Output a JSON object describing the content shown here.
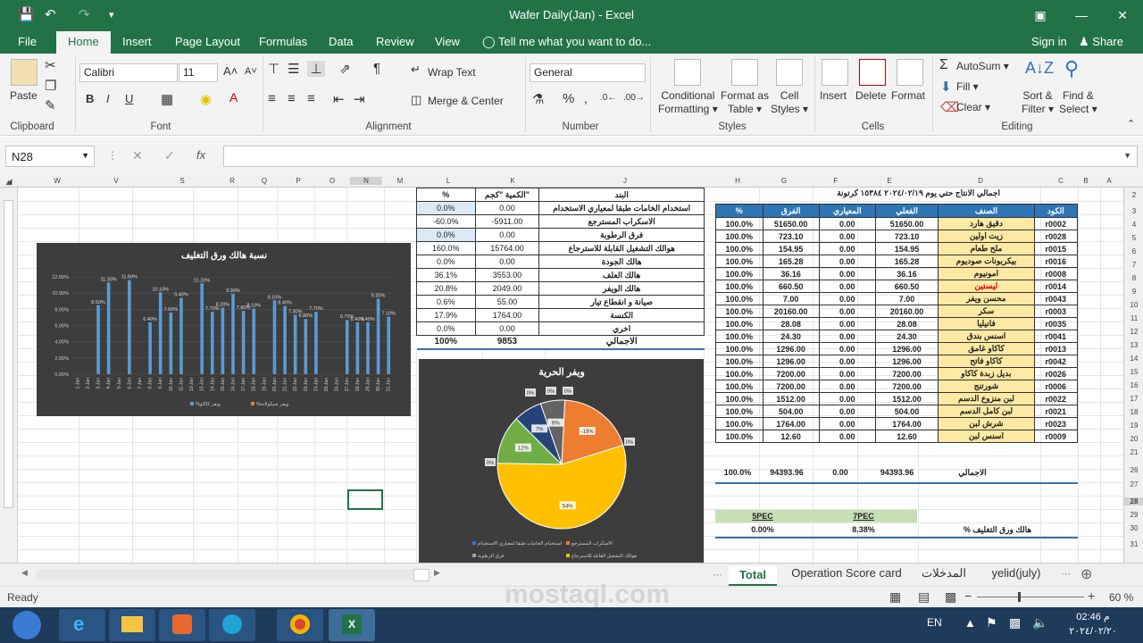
{
  "window": {
    "title": "Wafer Daily(Jan)  -  Excel",
    "sign_in": "Sign in",
    "share": "Share"
  },
  "tabs": [
    "File",
    "Home",
    "Insert",
    "Page Layout",
    "Formulas",
    "Data",
    "Review",
    "View"
  ],
  "tell_me": "Tell me what you want to do...",
  "ribbon": {
    "paste": "Paste",
    "clipboard": "Clipboard",
    "font_name": "Calibri",
    "font_size": "11",
    "font": "Font",
    "wrap_text": "Wrap Text",
    "merge_center": "Merge & Center",
    "alignment": "Alignment",
    "number_format": "General",
    "number": "Number",
    "conditional": "Conditional",
    "formatting": "Formatting",
    "format_as": "Format as",
    "table": "Table",
    "cell": "Cell",
    "styles_btn": "Styles",
    "styles": "Styles",
    "insert": "Insert",
    "delete": "Delete",
    "format": "Format",
    "cells": "Cells",
    "autosum": "AutoSum",
    "fill": "Fill",
    "clear": "Clear",
    "sort": "Sort &",
    "filter": "Filter",
    "find": "Find &",
    "select": "Select",
    "editing": "Editing"
  },
  "formula_bar": {
    "name_box": "N28",
    "fx": "fx"
  },
  "columns": [
    "W",
    "V",
    "S",
    "R",
    "Q",
    "P",
    "O",
    "N",
    "M",
    "L",
    "K",
    "J",
    "H",
    "G",
    "F",
    "E",
    "D",
    "C",
    "B",
    "A"
  ],
  "rows": [
    "2",
    "3",
    "4",
    "5",
    "6",
    "7",
    "8",
    "9",
    "10",
    "11",
    "12",
    "13",
    "14",
    "15",
    "16",
    "17",
    "18",
    "19",
    "20",
    "21",
    "26",
    "27",
    "28",
    "29",
    "30",
    "31"
  ],
  "right_table": {
    "header_line": "اجمالي الانتاج حتي يوم   ٢٠٢٤/٠٢/١٩   ١٥٣٨٤ كرتونة",
    "columns": [
      "%",
      "الفرق",
      "المعياري",
      "الفعلي",
      "الصنف",
      "الكود"
    ],
    "rows": [
      [
        "100.0%",
        "51650.00",
        "0.00",
        "51650.00",
        "دقيق هارد",
        "r0002"
      ],
      [
        "100.0%",
        "723.10",
        "0.00",
        "723.10",
        "زيت اولين",
        "r0028"
      ],
      [
        "100.0%",
        "154.95",
        "0.00",
        "154.95",
        "ملح طعام",
        "r0015"
      ],
      [
        "100.0%",
        "165.28",
        "0.00",
        "165.28",
        "بيكربونات صوديوم",
        "r0016"
      ],
      [
        "100.0%",
        "36.16",
        "0.00",
        "36.16",
        "امونيوم",
        "r0008"
      ],
      [
        "100.0%",
        "660.50",
        "0.00",
        "660.50",
        "ليستين",
        "r0014"
      ],
      [
        "100.0%",
        "7.00",
        "0.00",
        "7.00",
        "محسن ويفر",
        "r0043"
      ],
      [
        "100.0%",
        "20160.00",
        "0.00",
        "20160.00",
        "سكر",
        "r0003"
      ],
      [
        "100.0%",
        "28.08",
        "0.00",
        "28.08",
        "فانيليا",
        "r0035"
      ],
      [
        "100.0%",
        "24.30",
        "0.00",
        "24.30",
        "اسنس بندق",
        "r0041"
      ],
      [
        "100.0%",
        "1296.00",
        "0.00",
        "1296.00",
        "كاكاو غامق",
        "r0013"
      ],
      [
        "100.0%",
        "1296.00",
        "0.00",
        "1296.00",
        "كاكاو فاتح",
        "r0042"
      ],
      [
        "100.0%",
        "7200.00",
        "0.00",
        "7200.00",
        "بديل زبدة كاكاو",
        "r0026"
      ],
      [
        "100.0%",
        "7200.00",
        "0.00",
        "7200.00",
        "شورتنج",
        "r0006"
      ],
      [
        "100.0%",
        "1512.00",
        "0.00",
        "1512.00",
        "لبن منزوع الدسم",
        "r0022"
      ],
      [
        "100.0%",
        "504.00",
        "0.00",
        "504.00",
        "لبن كامل الدسم",
        "r0021"
      ],
      [
        "100.0%",
        "1764.00",
        "0.00",
        "1764.00",
        "شرش لبن",
        "r0023"
      ],
      [
        "100.0%",
        "12.60",
        "0.00",
        "12.60",
        "اسنس لبن",
        "r0009"
      ]
    ],
    "total": [
      "100.0%",
      "94393.96",
      "0.00",
      "94393.96",
      "الاجمالي",
      ""
    ]
  },
  "spec": {
    "h5": "5PEC",
    "h7": "7PEC",
    "v5": "0.00%",
    "v7": "8.38%",
    "label": "% هالك ورق التغليف"
  },
  "mid_table": {
    "columns": [
      "%",
      "الكمية \"كجم\"",
      "البند"
    ],
    "rows": [
      [
        "0.0%",
        "0.00",
        "استخدام الخامات طبقا لمعياري الاستخدام"
      ],
      [
        "-60.0%",
        "-5911.00",
        "الاسكراب المسترجع"
      ],
      [
        "0.0%",
        "0.00",
        "فرق الرطوبة"
      ],
      [
        "160.0%",
        "15764.00",
        "هوالك التشغيل القابلة للاسترجاع"
      ],
      [
        "0.0%",
        "0.00",
        "هالك الجودة"
      ],
      [
        "36.1%",
        "3553.00",
        "هالك العلف"
      ],
      [
        "20.8%",
        "2049.00",
        "هالك الويفر"
      ],
      [
        "0.6%",
        "55.00",
        "صيانة و انقطاع تيار"
      ],
      [
        "17.9%",
        "1764.00",
        "الكنسة"
      ],
      [
        "0.0%",
        "0.00",
        "اخري"
      ]
    ],
    "total": [
      "100%",
      "9853",
      "الاجمالي"
    ]
  },
  "chart_data": [
    {
      "type": "bar",
      "title": "نسبة هالك ورق التغليف",
      "categories": [
        "1-Jan",
        "2-Jan",
        "3-Jan",
        "4-Jan",
        "5-Jan",
        "6-Jan",
        "7-Jan",
        "8-Jan",
        "9-Jan",
        "10-Jan",
        "11-Jan",
        "12-Jan",
        "13-Jan",
        "14-Jan",
        "15-Jan",
        "16-Jan",
        "17-Jan",
        "18-Jan",
        "19-Jan",
        "20-Jan",
        "21-Jan",
        "22-Jan",
        "23-Jan",
        "24-Jan",
        "25-Jan",
        "26-Jan",
        "27-Jan",
        "28-Jan",
        "29-Jan",
        "30-Jan",
        "31-Jan"
      ],
      "y_ticks": [
        "0.00%",
        "2.00%",
        "4.00%",
        "6.00%",
        "8.00%",
        "10.00%",
        "12.00%"
      ],
      "ylim": [
        0,
        12
      ],
      "series": [
        {
          "name": "%ويفر كاكاو",
          "color": "#5b9bd5",
          "values": [
            0,
            0,
            8.5,
            11.3,
            0,
            11.6,
            0,
            6.4,
            10.1,
            7.6,
            9.4,
            0,
            11.2,
            7.7,
            8.2,
            9.9,
            7.8,
            8.1,
            0,
            9.1,
            8.4,
            7.3,
            6.8,
            7.7,
            0,
            0,
            6.7,
            6.4,
            6.4,
            9.3,
            7.1
          ]
        },
        {
          "name": "%ويفر شيكولاته",
          "color": "#ed7d31",
          "values": [
            0,
            0,
            0,
            0,
            0,
            0,
            0,
            0,
            0,
            0,
            0,
            0,
            0,
            0,
            0,
            0,
            0,
            0,
            0,
            0,
            0,
            0,
            0,
            0,
            0,
            0,
            0,
            0,
            0,
            0,
            0
          ]
        }
      ],
      "data_labels": [
        "",
        "",
        "8.50%",
        "11.30%",
        "",
        "11.60%",
        "",
        "6.40%",
        "10.10%",
        "7.60%",
        "9.40%",
        "",
        "11.20%",
        "7.70%",
        "8.20%",
        "9.90%",
        "7.80%",
        "8.10%",
        "",
        "9.10%",
        "8.40%",
        "7.30%",
        "6.80%",
        "7.70%",
        "",
        "",
        "6.70%",
        "6.40%",
        "6.40%",
        "9.30%",
        "7.10%"
      ]
    },
    {
      "type": "pie",
      "title": "ويفر الحرية",
      "slices": [
        {
          "name": "استخدام الخامات طبقا لمعياري الاستخدام",
          "value": 0,
          "label": "0%",
          "color": "#4472c4"
        },
        {
          "name": "الاسكراب المسترجع",
          "value": 19,
          "label": "-19%",
          "color": "#ed7d31"
        },
        {
          "name": "فرق الرطوبة",
          "value": 0,
          "label": "0%",
          "color": "#a5a5a5"
        },
        {
          "name": "هوالك التشغيل القابلة للاسترجاع",
          "value": 54,
          "label": "54%",
          "color": "#ffc000"
        },
        {
          "name": "هالك الجودة",
          "value": 0,
          "label": "0%",
          "color": "#5b9bd5"
        },
        {
          "name": "هالك العلف",
          "value": 12,
          "label": "12%",
          "color": "#70ad47"
        },
        {
          "name": "هالك الويفر",
          "value": 7,
          "label": "7%",
          "color": "#264478"
        },
        {
          "name": "صيانة و انقطاع تيار",
          "value": 0,
          "label": "0%",
          "color": "#9e480e"
        },
        {
          "name": "الكنسة",
          "value": 6,
          "label": "6%",
          "color": "#636363"
        },
        {
          "name": "اخري",
          "value": 0,
          "label": "0%",
          "color": "#997300"
        }
      ],
      "legend_items": [
        "استخدام الخامات طبقا لمعياري الاستخدام",
        "الاسكراب المسترجع",
        "فرق الرطوبة",
        "هوالك التشغيل القابلة للاسترجاع"
      ]
    }
  ],
  "sheet_tabs": [
    "Total",
    "Operation Score card",
    "المدخلات",
    "yelid(july)"
  ],
  "status": {
    "ready": "Ready",
    "zoom": "60 %"
  },
  "taskbar": {
    "lang": "EN",
    "time": "02:46 م",
    "date": "٢٠٢٤/٠٢/٢٠"
  },
  "watermark": "mostaql.com",
  "colors": {
    "excel_green": "#217346",
    "header_blue": "#2e75b6",
    "name_yellow": "#fde9a4",
    "spec_green": "#c6e0b4"
  }
}
